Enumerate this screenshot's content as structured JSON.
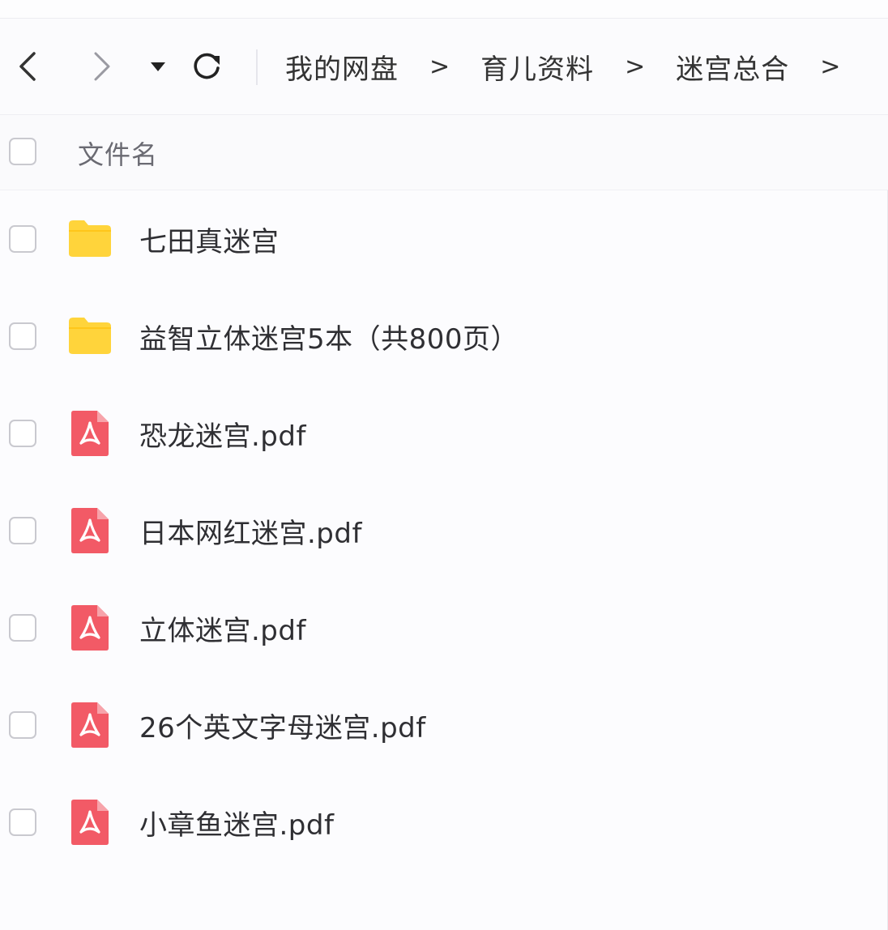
{
  "toolbar": {
    "back_icon": "chevron-left-icon",
    "forward_icon": "chevron-right-icon",
    "dropdown_icon": "caret-down-icon",
    "refresh_icon": "refresh-icon"
  },
  "breadcrumb": {
    "items": [
      "我的网盘",
      "育儿资料",
      "迷宫总合"
    ],
    "separator": ">"
  },
  "header": {
    "column_name": "文件名"
  },
  "files": [
    {
      "name": "七田真迷宫",
      "type": "folder",
      "icon": "folder-icon"
    },
    {
      "name": "益智立体迷宫5本（共800页）",
      "type": "folder",
      "icon": "folder-icon"
    },
    {
      "name": "恐龙迷宫.pdf",
      "type": "pdf",
      "icon": "pdf-icon"
    },
    {
      "name": "日本网红迷宫.pdf",
      "type": "pdf",
      "icon": "pdf-icon"
    },
    {
      "name": "立体迷宫.pdf",
      "type": "pdf",
      "icon": "pdf-icon"
    },
    {
      "name": "26个英文字母迷宫.pdf",
      "type": "pdf",
      "icon": "pdf-icon"
    },
    {
      "name": "小章鱼迷宫.pdf",
      "type": "pdf",
      "icon": "pdf-icon"
    }
  ],
  "colors": {
    "folder": "#ffd43b",
    "folder_tab": "#ffc61a",
    "pdf": "#f25a66",
    "pdf_fold": "#f7a3aa"
  }
}
